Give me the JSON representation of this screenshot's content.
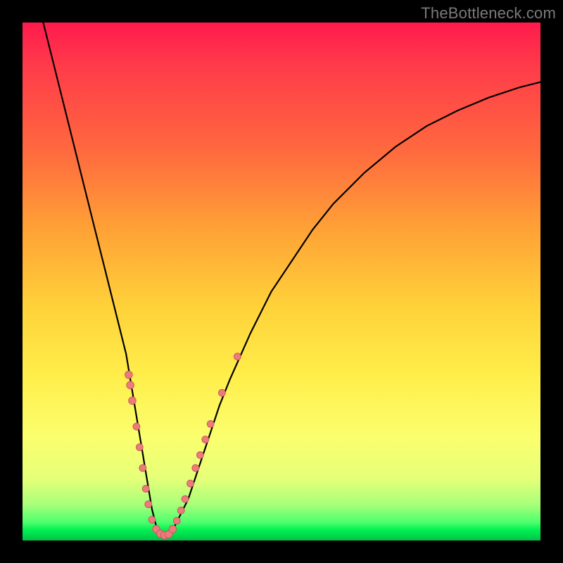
{
  "watermark": "TheBottleneck.com",
  "colors": {
    "frame": "#000000",
    "curve": "#000000",
    "bead_fill": "#ef7a7c",
    "bead_stroke": "#c55c5e",
    "gradient_top": "#ff1a4d",
    "gradient_mid": "#ffee4a",
    "gradient_bottom": "#00c24a"
  },
  "chart_data": {
    "type": "line",
    "title": "",
    "xlabel": "",
    "ylabel": "",
    "xlim": [
      0,
      100
    ],
    "ylim": [
      0,
      100
    ],
    "note": "Axes are unlabeled in the image; x and y normalized 0–100. y is plotted with origin at bottom (low y = green band).",
    "series": [
      {
        "name": "curve",
        "x": [
          4,
          6,
          8,
          10,
          12,
          14,
          16,
          18,
          20,
          22,
          23,
          24,
          25,
          26,
          27,
          28,
          29,
          30,
          32,
          34,
          36,
          38,
          40,
          44,
          48,
          52,
          56,
          60,
          66,
          72,
          78,
          84,
          90,
          96,
          100
        ],
        "y": [
          100,
          92,
          84,
          76,
          68,
          60,
          52,
          44,
          36,
          24,
          18,
          12,
          6,
          2,
          1,
          1,
          2,
          4,
          8,
          14,
          20,
          26,
          31,
          40,
          48,
          54,
          60,
          65,
          71,
          76,
          80,
          83,
          85.5,
          87.5,
          88.5
        ]
      }
    ],
    "markers": [
      {
        "x": 20.5,
        "y": 32,
        "r": 1.3
      },
      {
        "x": 20.8,
        "y": 30,
        "r": 1.3
      },
      {
        "x": 21.2,
        "y": 27,
        "r": 1.3
      },
      {
        "x": 22.0,
        "y": 22,
        "r": 1.2
      },
      {
        "x": 22.6,
        "y": 18,
        "r": 1.2
      },
      {
        "x": 23.2,
        "y": 14,
        "r": 1.2
      },
      {
        "x": 23.8,
        "y": 10,
        "r": 1.2
      },
      {
        "x": 24.3,
        "y": 7,
        "r": 1.2
      },
      {
        "x": 25.0,
        "y": 4,
        "r": 1.2
      },
      {
        "x": 25.8,
        "y": 2.2,
        "r": 1.3
      },
      {
        "x": 26.6,
        "y": 1.3,
        "r": 1.3
      },
      {
        "x": 27.4,
        "y": 1.0,
        "r": 1.3
      },
      {
        "x": 28.2,
        "y": 1.2,
        "r": 1.3
      },
      {
        "x": 29.0,
        "y": 2.2,
        "r": 1.3
      },
      {
        "x": 29.8,
        "y": 3.8,
        "r": 1.2
      },
      {
        "x": 30.6,
        "y": 5.8,
        "r": 1.2
      },
      {
        "x": 31.4,
        "y": 8.0,
        "r": 1.2
      },
      {
        "x": 32.4,
        "y": 11,
        "r": 1.2
      },
      {
        "x": 33.4,
        "y": 14,
        "r": 1.2
      },
      {
        "x": 34.3,
        "y": 16.5,
        "r": 1.2
      },
      {
        "x": 35.3,
        "y": 19.5,
        "r": 1.2
      },
      {
        "x": 36.3,
        "y": 22.5,
        "r": 1.2
      },
      {
        "x": 38.5,
        "y": 28.5,
        "r": 1.2
      },
      {
        "x": 41.5,
        "y": 35.5,
        "r": 1.2
      }
    ]
  }
}
